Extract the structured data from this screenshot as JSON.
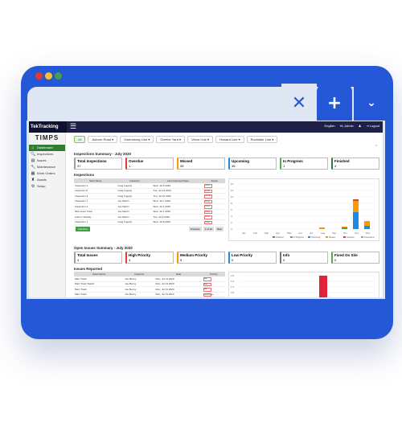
{
  "window": {
    "controls": {
      "close": "✕",
      "new_tab": "+",
      "chevron": "⌄"
    },
    "dot_colors": [
      "#e53935",
      "#fbc02d",
      "#43a047"
    ]
  },
  "app": {
    "logo": "TekTracking",
    "brand": "TIMPS",
    "top_right": {
      "language": "English",
      "user": "Hi, Admin",
      "logout": "Logout"
    },
    "sidebar": [
      {
        "label": "Dashboard",
        "icon": "⌂",
        "active": true
      },
      {
        "label": "Inspections",
        "icon": "🔍"
      },
      {
        "label": "Issues",
        "icon": "▤"
      },
      {
        "label": "Maintenance",
        "icon": "🔧"
      },
      {
        "label": "Work Orders",
        "icon": "▦"
      },
      {
        "label": "Assets",
        "icon": "♜"
      },
      {
        "label": "Setup",
        "icon": "⚙"
      }
    ],
    "filters": [
      "All",
      "Auburn Road",
      "Owensburg Line",
      "Greene Yard",
      "Victor Line",
      "Howard Line",
      "Rochdale Line"
    ],
    "inspections_summary": {
      "title": "Inspections Summary - July 2020",
      "cards": [
        {
          "title": "Total Inspections",
          "value": "37",
          "color": "#9e9e9e"
        },
        {
          "title": "Overdue",
          "value": "1",
          "color": "#e53935"
        },
        {
          "title": "Missed",
          "value": "35",
          "color": "#ff9800"
        },
        {
          "title": "Upcoming",
          "value": "36",
          "color": "#1e88e5"
        },
        {
          "title": "In Progress",
          "value": "1",
          "color": "#4caf50"
        },
        {
          "title": "Finished",
          "value": "4",
          "color": "#2e7d32"
        }
      ]
    },
    "inspections_table": {
      "title": "Inspections",
      "headers": [
        "Start Name",
        "Inspector",
        "Last Inspected Date",
        "Status"
      ],
      "rows": [
        [
          "Inspection 4",
          "Greg Fogarty",
          "Wed, Jul 8 2020",
          "Pause"
        ],
        [
          "Inspection 8",
          "Greg Fogarty",
          "Tue, Jul 14 2020",
          "Pause"
        ],
        [
          "Inspection 3",
          "Greg Fogarty",
          "Thu, Jul 10 2020",
          "Resume"
        ],
        [
          "Inspection 7",
          "Joe Martin",
          "Wed, Jul 7 2020",
          "Pause"
        ],
        [
          "Inspection 2",
          "Joe Martin",
          "Wed, Jul 1 2020",
          "Pause"
        ],
        [
          "Mid Lance Track",
          "Joe Martin",
          "Wed, Jul 1 2020",
          "Pause"
        ],
        [
          "Auburn Weekly",
          "Joe Martin",
          "Tue, Jul 5 2020",
          "Pause"
        ],
        [
          "Inspection 1",
          "Greg Fogarty",
          "Wed, Jul 8 2020",
          "Pause"
        ]
      ],
      "add_button": "Add Row",
      "pager": [
        "Previous",
        "1 of 10",
        "Next"
      ]
    },
    "inspections_chart": {
      "y_ticks": [
        "15",
        "12",
        "10",
        "8",
        "6",
        "4",
        "2",
        "0"
      ],
      "categories": [
        "Jan",
        "Feb",
        "Mar",
        "Apr",
        "May",
        "Jun",
        "Jul",
        "Aug",
        "Sep",
        "Oct",
        "Nov",
        "Dec"
      ],
      "legend": [
        "Finished",
        "In Progress",
        "Upcoming",
        "Missed",
        "Overdue",
        "Inspections"
      ]
    },
    "issues_summary": {
      "title": "Open Issues Summary - July 2020",
      "cards": [
        {
          "title": "Total Issues",
          "value": "4",
          "color": "#9e9e9e"
        },
        {
          "title": "High Priority",
          "value": "3",
          "color": "#e53935"
        },
        {
          "title": "Medium Priority",
          "value": "5",
          "color": "#ff9800"
        },
        {
          "title": "Low Priority",
          "value": "0",
          "color": "#1e88e5"
        },
        {
          "title": "Info",
          "value": "0",
          "color": "#757575"
        },
        {
          "title": "Fixed On Site",
          "value": "0",
          "color": "#4caf50"
        }
      ]
    },
    "issues_table": {
      "title": "Issues Reported",
      "headers": [
        "Asset Name",
        "Inspector",
        "Date",
        "Priority"
      ],
      "rows": [
        [
          "Main Track",
          "Joe Benny",
          "Mon, Jul 13 2020",
          "High"
        ],
        [
          "Main Track Switch",
          "Joe Benny",
          "Mon, Jul 13 2020",
          "High"
        ],
        [
          "Main Track",
          "Joe Benny",
          "Mon, Jul 13 2020",
          "High"
        ],
        [
          "Main Track",
          "Joe Benny",
          "Mon, Jul 13 2020",
          "Fixed On Site"
        ]
      ]
    },
    "issues_chart": {
      "y_ticks": [
        "2.0",
        "1.5",
        "1.0",
        "0.5"
      ]
    }
  }
}
